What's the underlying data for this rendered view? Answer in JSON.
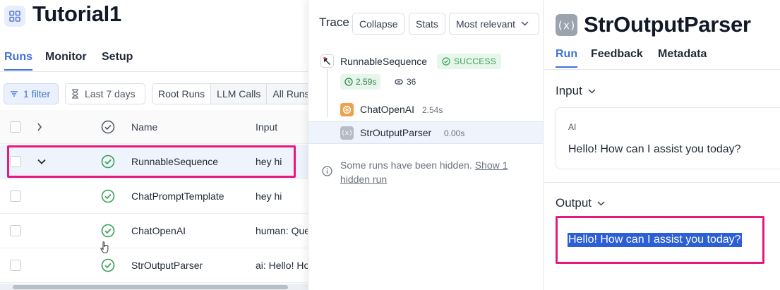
{
  "project": {
    "title": "Tutorial1",
    "icon": "grid-icon"
  },
  "top_tabs": [
    "Runs",
    "Monitor",
    "Setup"
  ],
  "filters": {
    "filter_btn": "1 filter",
    "date_btn": "Last 7 days",
    "segments": [
      "Root Runs",
      "LLM Calls",
      "All Runs"
    ]
  },
  "table": {
    "headers": {
      "name": "Name",
      "input": "Input"
    },
    "rows": [
      {
        "name": "RunnableSequence",
        "input": "hey hi"
      },
      {
        "name": "ChatPromptTemplate",
        "input": "hey hi"
      },
      {
        "name": "ChatOpenAI",
        "input": "human: Question: hey hi"
      },
      {
        "name": "StrOutputParser",
        "input": "ai: Hello! How can I assist"
      }
    ]
  },
  "trace": {
    "label": "Trace",
    "buttons": {
      "collapse": "Collapse",
      "stats": "Stats",
      "sort": "Most relevant"
    },
    "root": {
      "name": "RunnableSequence",
      "status": "SUCCESS",
      "time": "2.59s",
      "tokens": "36"
    },
    "children": [
      {
        "name": "ChatOpenAI",
        "time": "2.54s"
      },
      {
        "name": "StrOutputParser",
        "time": "0.00s"
      }
    ],
    "hidden_note": "Some runs have been hidden.",
    "hidden_link": "Show 1 hidden run"
  },
  "detail": {
    "icon_glyph": "(x)",
    "title": "StrOutputParser",
    "tabs": [
      "Run",
      "Feedback",
      "Metadata"
    ],
    "input_label": "Input",
    "input_role": "AI",
    "input_message": "Hello! How can I assist you today?",
    "output_label": "Output",
    "output_text": "Hello! How can I assist you today?"
  },
  "colors": {
    "accent": "#3f72d9",
    "highlight": "#e8197d",
    "success": "#3aa05a",
    "selection": "#2c5fd6"
  }
}
